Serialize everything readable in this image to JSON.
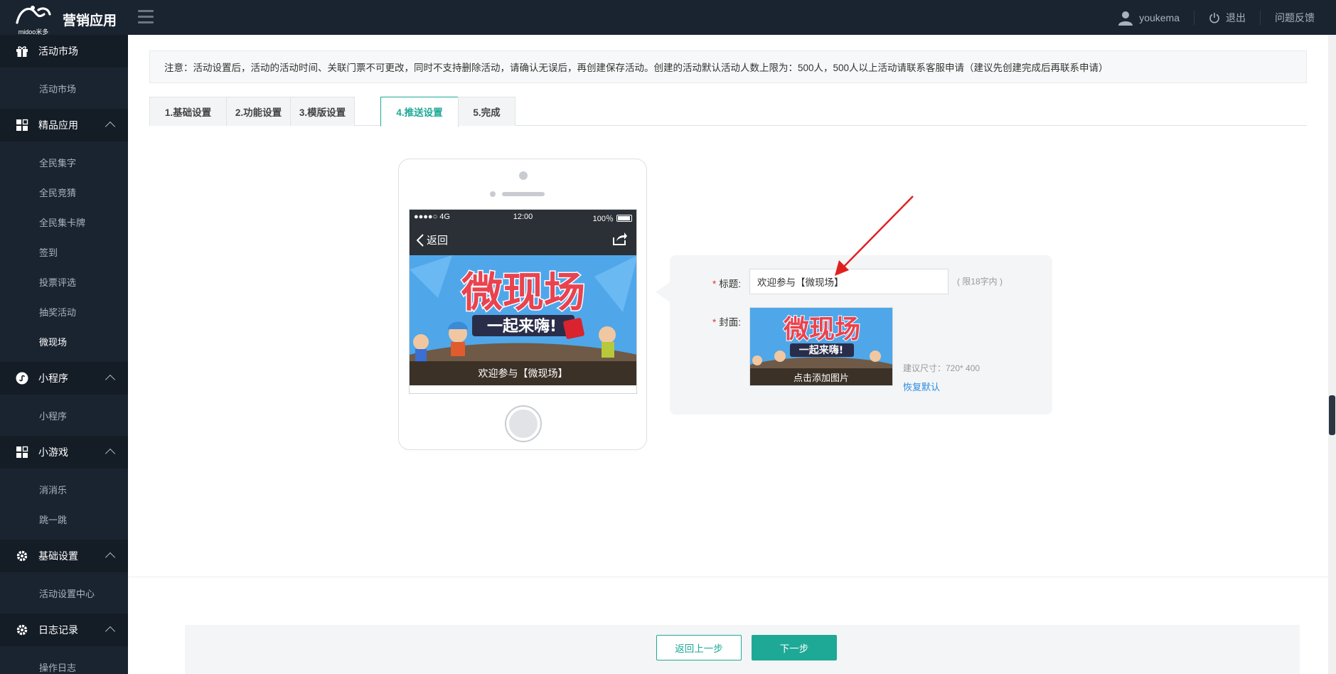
{
  "header": {
    "logo_text": "midoo米多",
    "app_title": "营销应用",
    "username": "youkema",
    "logout_label": "退出",
    "feedback_label": "问题反馈"
  },
  "sidebar": {
    "sections": [
      {
        "label": "活动市场",
        "icon": "gift-icon",
        "items": [
          "活动市场"
        ]
      },
      {
        "label": "精品应用",
        "icon": "grid-icon",
        "items": [
          "全民集字",
          "全民竞猜",
          "全民集卡牌",
          "签到",
          "投票评选",
          "抽奖活动",
          "微现场"
        ]
      },
      {
        "label": "小程序",
        "icon": "miniprogram-icon",
        "items": [
          "小程序"
        ]
      },
      {
        "label": "小游戏",
        "icon": "grid-icon",
        "items": [
          "消消乐",
          "跳一跳"
        ]
      },
      {
        "label": "基础设置",
        "icon": "gear-icon",
        "items": [
          "活动设置中心"
        ]
      },
      {
        "label": "日志记录",
        "icon": "gear-icon",
        "items": [
          "操作日志"
        ]
      }
    ],
    "active_item": "微现场"
  },
  "notice": "注意：活动设置后，活动的活动时间、关联门票不可更改，同时不支持删除活动，请确认无误后，再创建保存活动。创建的活动默认活动人数上限为：500人，500人以上活动请联系客服申请（建议先创建完成后再联系申请）",
  "tabs": [
    {
      "label": "1.基础设置",
      "active": false
    },
    {
      "label": "2.功能设置",
      "active": false
    },
    {
      "label": "3.模版设置",
      "active": false
    },
    {
      "label": "4.推送设置",
      "active": true
    },
    {
      "label": "5.完成",
      "active": false
    }
  ],
  "phone": {
    "signal": "●●●●○ 4G",
    "time": "12:00",
    "battery": "100％",
    "back_label": "返回",
    "banner_title": "微现场",
    "banner_subtitle": "一起来嗨!",
    "banner_caption": "欢迎参与【微现场】"
  },
  "form": {
    "title_label": "标题:",
    "title_value": "欢迎参与【微现场】",
    "title_limit": "( 限18字内 )",
    "cover_label": "封面:",
    "cover_caption": "点击添加图片",
    "size_hint": "建议尺寸：720* 400",
    "restore_label": "恢复默认",
    "required_mark": "*"
  },
  "footer": {
    "prev_label": "返回上一步",
    "next_label": "下一步"
  },
  "colors": {
    "accent": "#1ea996",
    "sidebar_bg": "#1a2431",
    "link": "#2a8de0",
    "annotation_arrow": "#e0201f"
  }
}
